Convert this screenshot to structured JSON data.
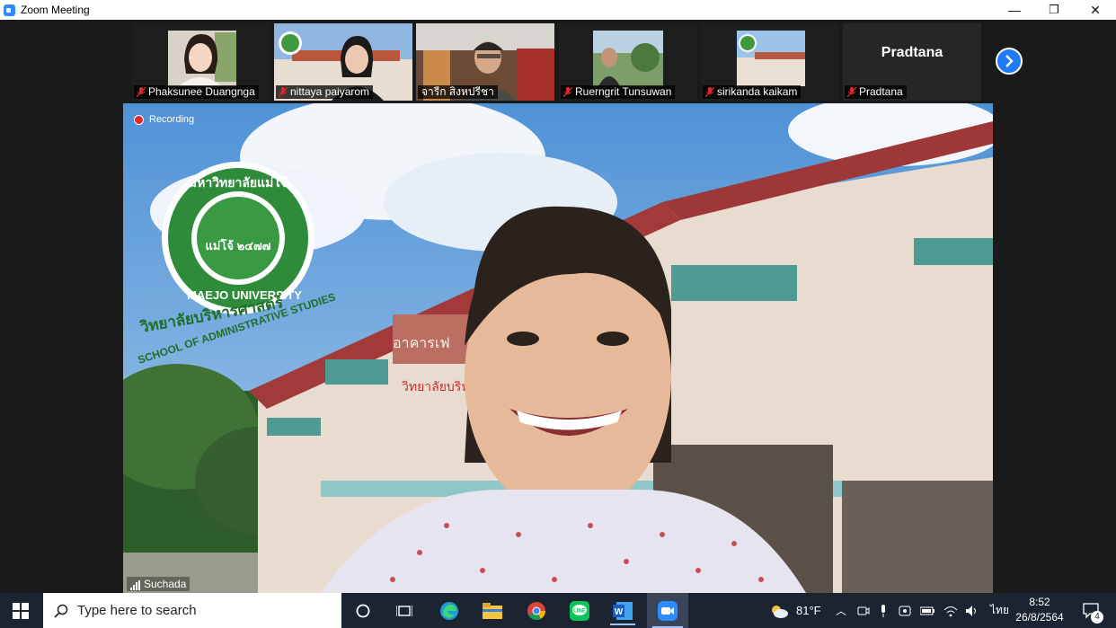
{
  "window": {
    "title": "Zoom Meeting",
    "minimize": "—",
    "restore": "❐",
    "close": "✕"
  },
  "participants": [
    {
      "name": "Phaksunee Duangnga"
    },
    {
      "name": "nittaya paiyarom"
    },
    {
      "name": "จารีก สิงหปรีชา"
    },
    {
      "name": "Ruerngrit Tunsuwan"
    },
    {
      "name": "sirikanda kaikam"
    },
    {
      "name": "Pradtana",
      "big_label": "Pradtana"
    }
  ],
  "main_video": {
    "recording_label": "Recording",
    "speaker_name": "Suchada",
    "logo_text_top": "มหาวิทยาลัยแม่โจ้",
    "logo_text_en": "MAEJO UNIVERSITY",
    "logo_center": "แม่โจ้ ๒๔๗๗",
    "logo_sub_th": "วิทยาลัยบริหารศาสตร์",
    "logo_sub_en": "SCHOOL OF ADMINISTRATIVE STUDIES",
    "building_sign": "อาคารเฟ",
    "building_sign2": "วิทยาลัยบริหารศาสตร์"
  },
  "taskbar": {
    "search_placeholder": "Type here to search",
    "weather": "81°F",
    "language": "ไทย",
    "time": "8:52",
    "date": "26/8/2564",
    "notification_count": "4"
  },
  "colors": {
    "zoom_blue": "#2d8cff",
    "taskbar": "#1c2331",
    "mic_muted": "#e02828"
  }
}
